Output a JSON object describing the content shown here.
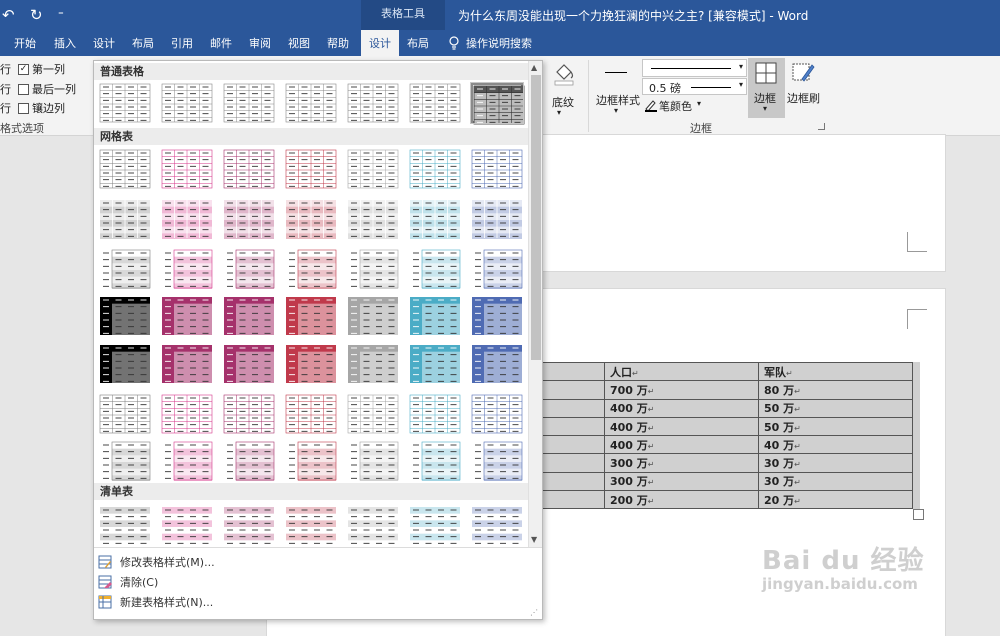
{
  "app": {
    "context_tab_group": "表格工具",
    "document_title": "为什么东周没能出现一个力挽狂澜的中兴之主? [兼容模式] - Word"
  },
  "quick_access": {
    "undo": "↶",
    "redo": "↻",
    "customize": "⁼"
  },
  "tabs": [
    {
      "label": "开始"
    },
    {
      "label": "插入"
    },
    {
      "label": "设计"
    },
    {
      "label": "布局"
    },
    {
      "label": "引用"
    },
    {
      "label": "邮件"
    },
    {
      "label": "审阅"
    },
    {
      "label": "视图"
    },
    {
      "label": "帮助"
    },
    {
      "label": "设计",
      "active": true
    },
    {
      "label": "布局"
    }
  ],
  "tell_me": "操作说明搜索",
  "style_options": {
    "row1_left": "行",
    "row1_right": "第一列",
    "row2_left": "行",
    "row2_right": "最后一列",
    "row3_left": "行",
    "row3_right": "镶边列",
    "group_label": "格式选项",
    "first_column_checked": true,
    "last_column_checked": false,
    "banded_columns_checked": false
  },
  "ribbon": {
    "shading_label": "底纹",
    "border_style_label": "边框样式",
    "pen_weight": "0.5 磅",
    "pen_color_label": "笔颜色",
    "borders_label": "边框",
    "border_painter_label": "边框刷",
    "borders_group_label": "边框"
  },
  "gallery": {
    "sections": [
      {
        "title": "普通表格"
      },
      {
        "title": "网格表"
      },
      {
        "title": "清单表"
      }
    ],
    "menu": [
      {
        "label": "修改表格样式(M)..."
      },
      {
        "label": "清除(C)"
      },
      {
        "label": "新建表格样式(N)..."
      }
    ],
    "colors": {
      "gray": "#7f7f7f",
      "black": "#000000",
      "pink": "#d6378a",
      "plum": "#a5316b",
      "red": "#c0394b",
      "silver": "#a6a6a6",
      "cyan": "#4bacc6",
      "blue": "#4f6bb3"
    }
  },
  "table": {
    "headers": [
      "人口",
      "军队"
    ],
    "rows": [
      [
        "700 万",
        "80 万"
      ],
      [
        "400 万",
        "50 万"
      ],
      [
        "400 万",
        "50 万"
      ],
      [
        "400 万",
        "40 万"
      ],
      [
        "300 万",
        "30 万"
      ],
      [
        "300 万",
        "30 万"
      ],
      [
        "200 万",
        "20 万"
      ]
    ]
  },
  "watermark": {
    "brand": "Bai  du 经验",
    "url": "jingyan.baidu.com"
  }
}
